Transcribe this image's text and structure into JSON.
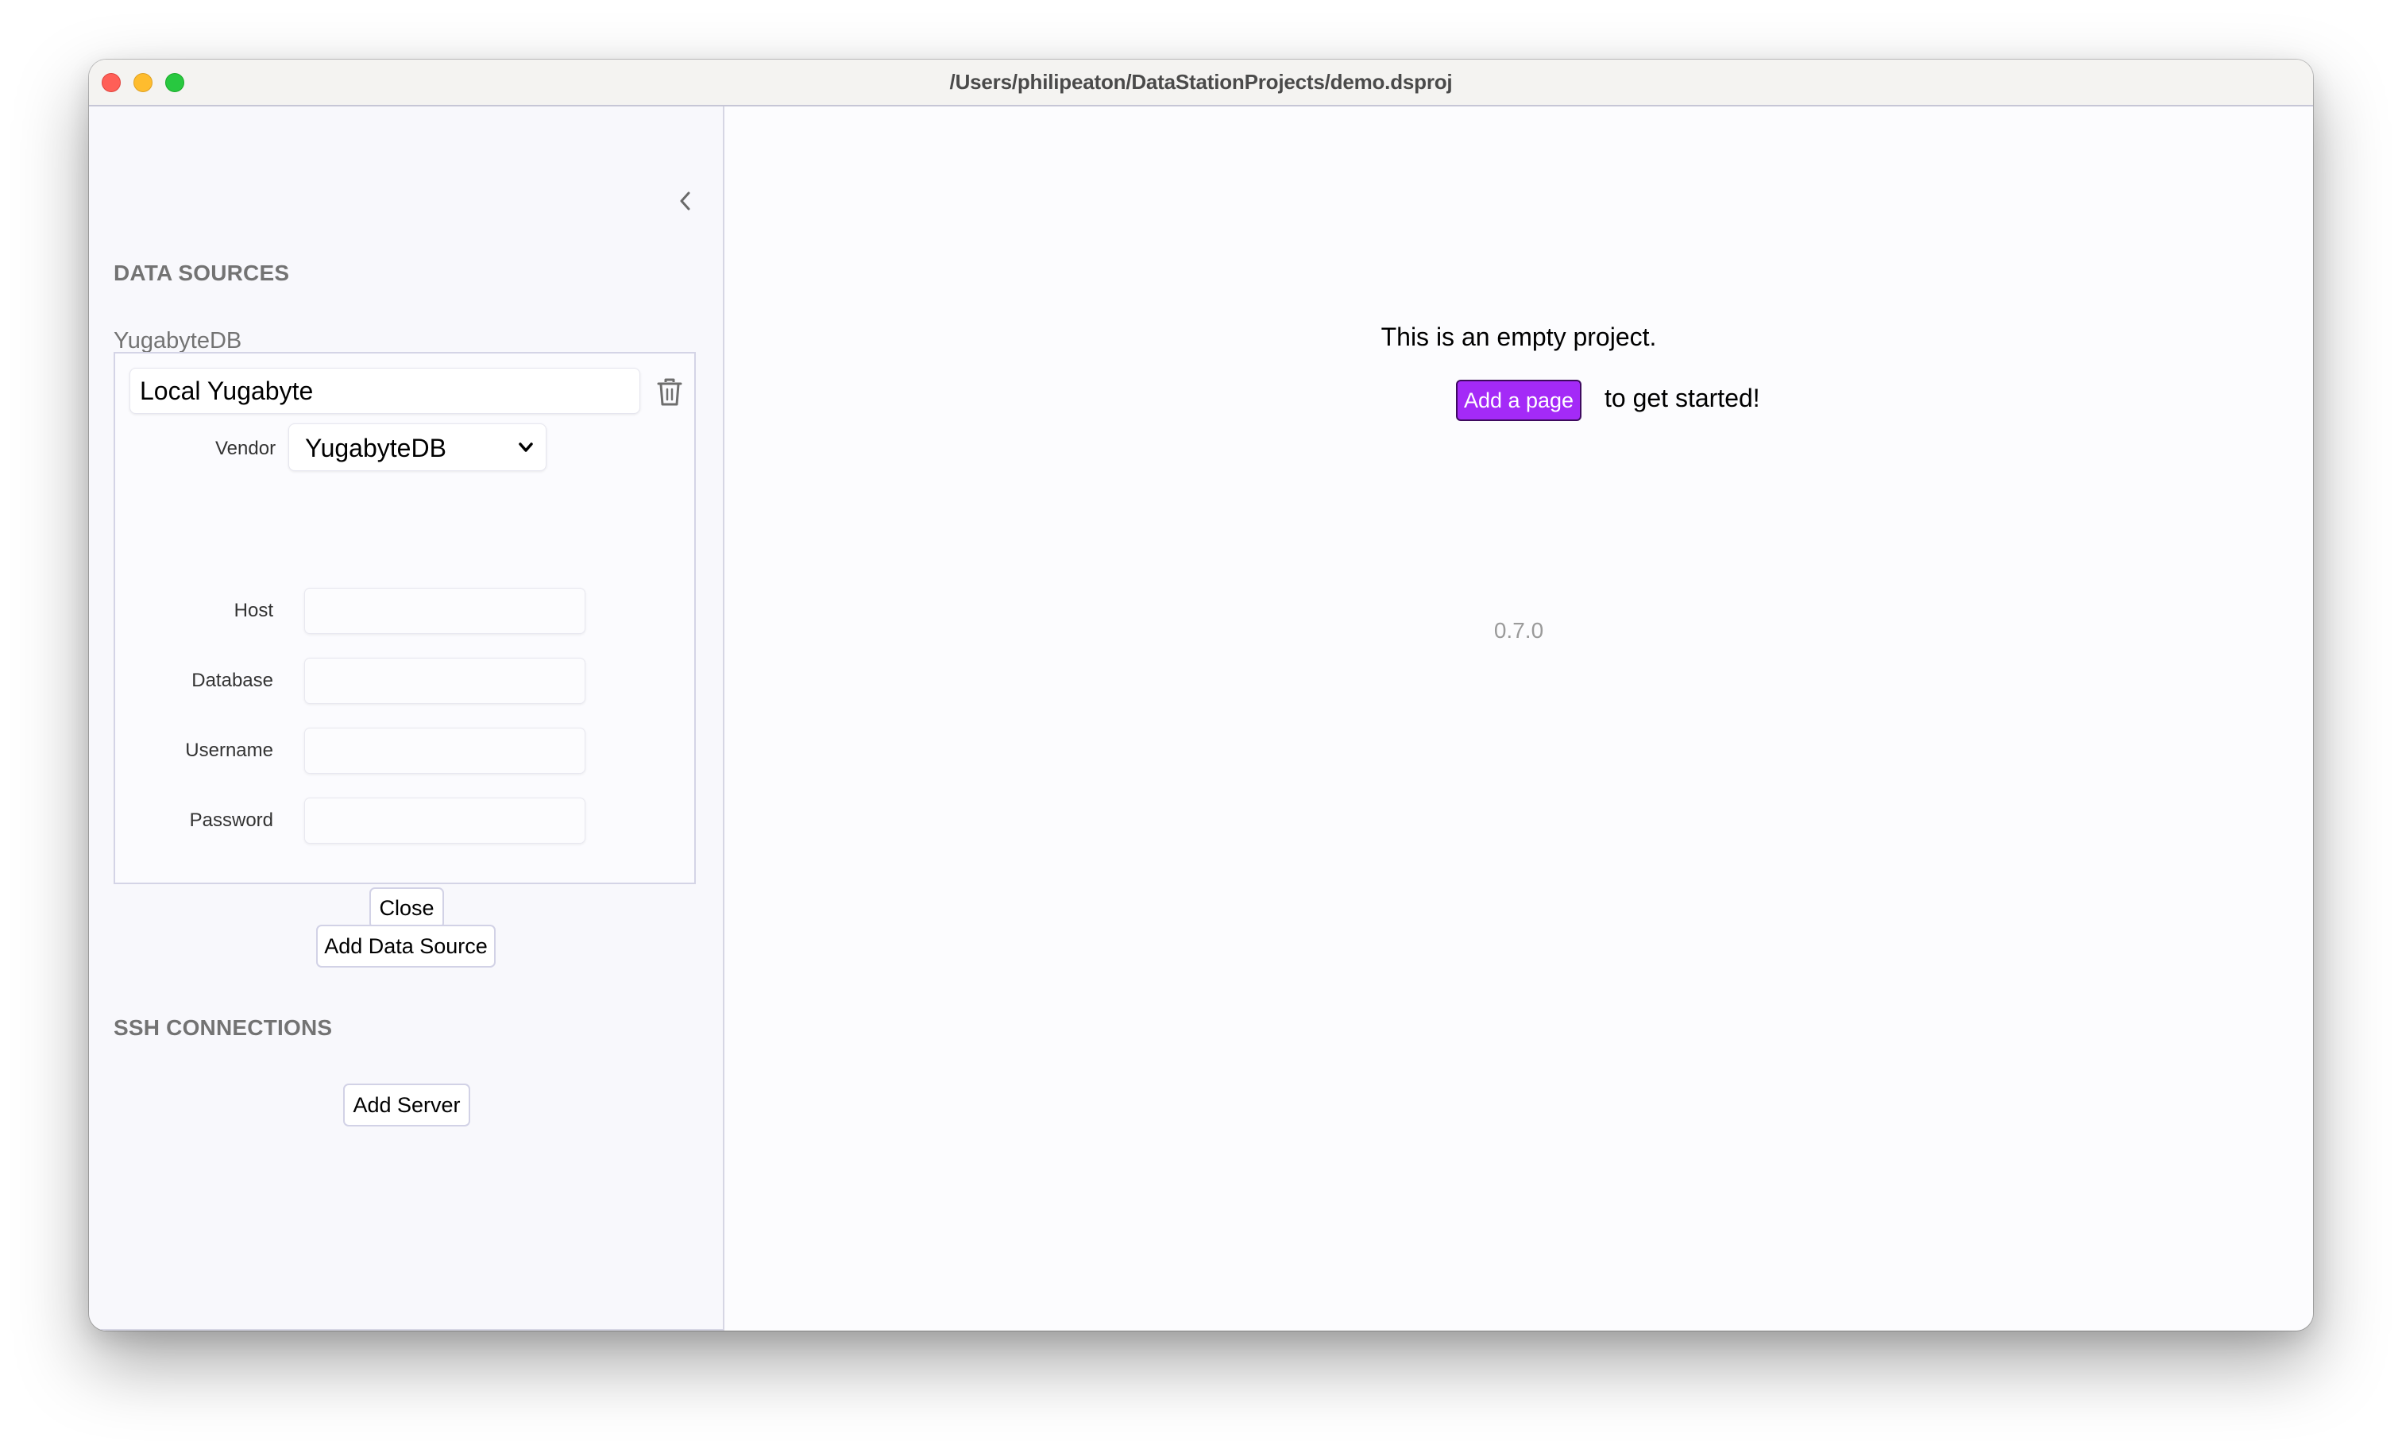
{
  "window": {
    "title": "/Users/philipeaton/DataStationProjects/demo.dsproj",
    "controls": [
      "close",
      "minimize",
      "zoom"
    ]
  },
  "sidebar": {
    "collapse_icon": "chevron-left-icon",
    "data_sources": {
      "section_title": "DATA SOURCES",
      "items": [
        {
          "type_label": "YugabyteDB",
          "name": "Local Yugabyte",
          "delete_icon": "trash-icon",
          "vendor_label": "Vendor",
          "vendor_value": "YugabyteDB",
          "fields": [
            {
              "label": "Host",
              "value": ""
            },
            {
              "label": "Database",
              "value": ""
            },
            {
              "label": "Username",
              "value": ""
            },
            {
              "label": "Password",
              "value": ""
            }
          ],
          "close_label": "Close"
        }
      ],
      "add_label": "Add Data Source"
    },
    "ssh_connections": {
      "section_title": "SSH CONNECTIONS",
      "add_label": "Add Server"
    }
  },
  "main": {
    "empty_message": "This is an empty project.",
    "add_page_label": "Add a page",
    "get_started_text": "to get started!",
    "version": "0.7.0",
    "accent_color": "#a42af7"
  }
}
